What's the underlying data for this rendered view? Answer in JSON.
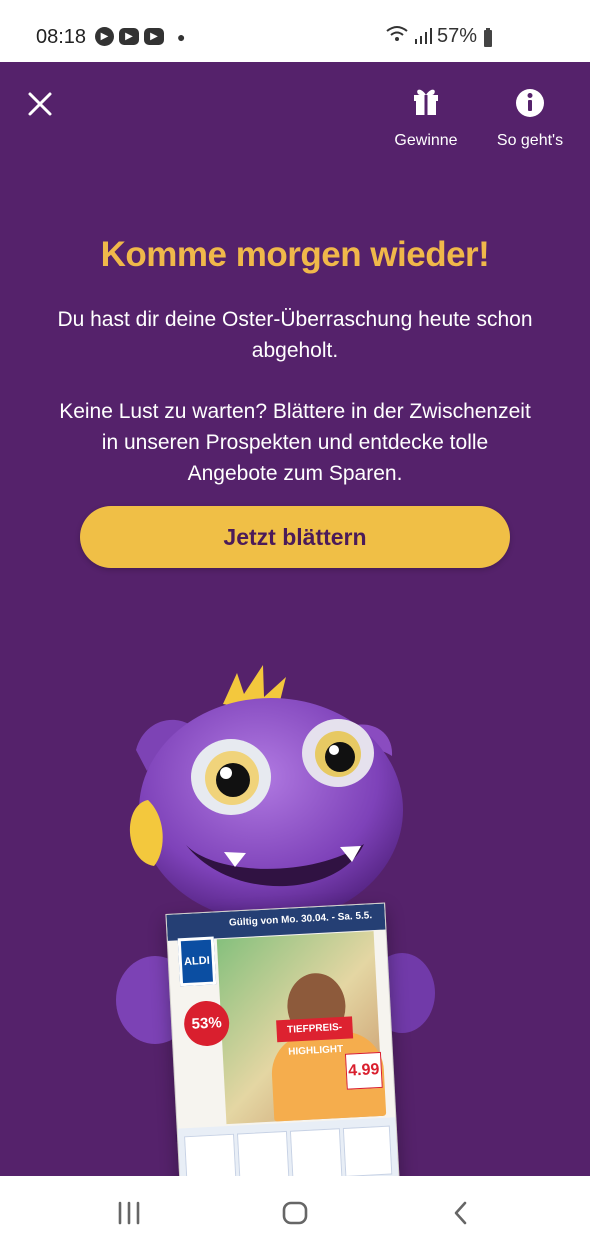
{
  "status": {
    "time": "08:18",
    "battery": "57%",
    "icons": [
      "play-circle-icon",
      "youtube-icon",
      "youtube-icon",
      "notification-dot-icon",
      "wifi-icon",
      "signal-icon",
      "battery-icon"
    ]
  },
  "header": {
    "close_icon": "close-icon",
    "gift_label": "Gewinne",
    "gift_icon": "gift-icon",
    "info_label": "So geht's",
    "info_icon": "info-icon"
  },
  "content": {
    "headline": "Komme morgen wieder!",
    "paragraph1": "Du hast dir deine Oster-Überraschung heute schon abgeholt.",
    "paragraph2": "Keine Lust zu warten? Blättere in der Zwischenzeit in unseren Prospekten und entdecke tolle Angebote zum Sparen.",
    "button_label": "Jetzt blättern"
  },
  "illustration": {
    "mascot_icon": "purple-monster-mascot",
    "brochure_date": "Gültig von Mo. 30.04. - Sa. 5.5.",
    "brochure_brand": "ALDI",
    "brochure_discount": "53%",
    "brochure_tag": "TIEFPREIS-HIGHLIGHT",
    "brochure_price": "4.99"
  },
  "navigation": {
    "recent_icon": "recent-apps-icon",
    "home_icon": "home-icon",
    "back_icon": "back-icon"
  },
  "colors": {
    "background": "#55226b",
    "headline": "#f0b84a",
    "button": "#f0bf46",
    "text": "#ffffff"
  }
}
